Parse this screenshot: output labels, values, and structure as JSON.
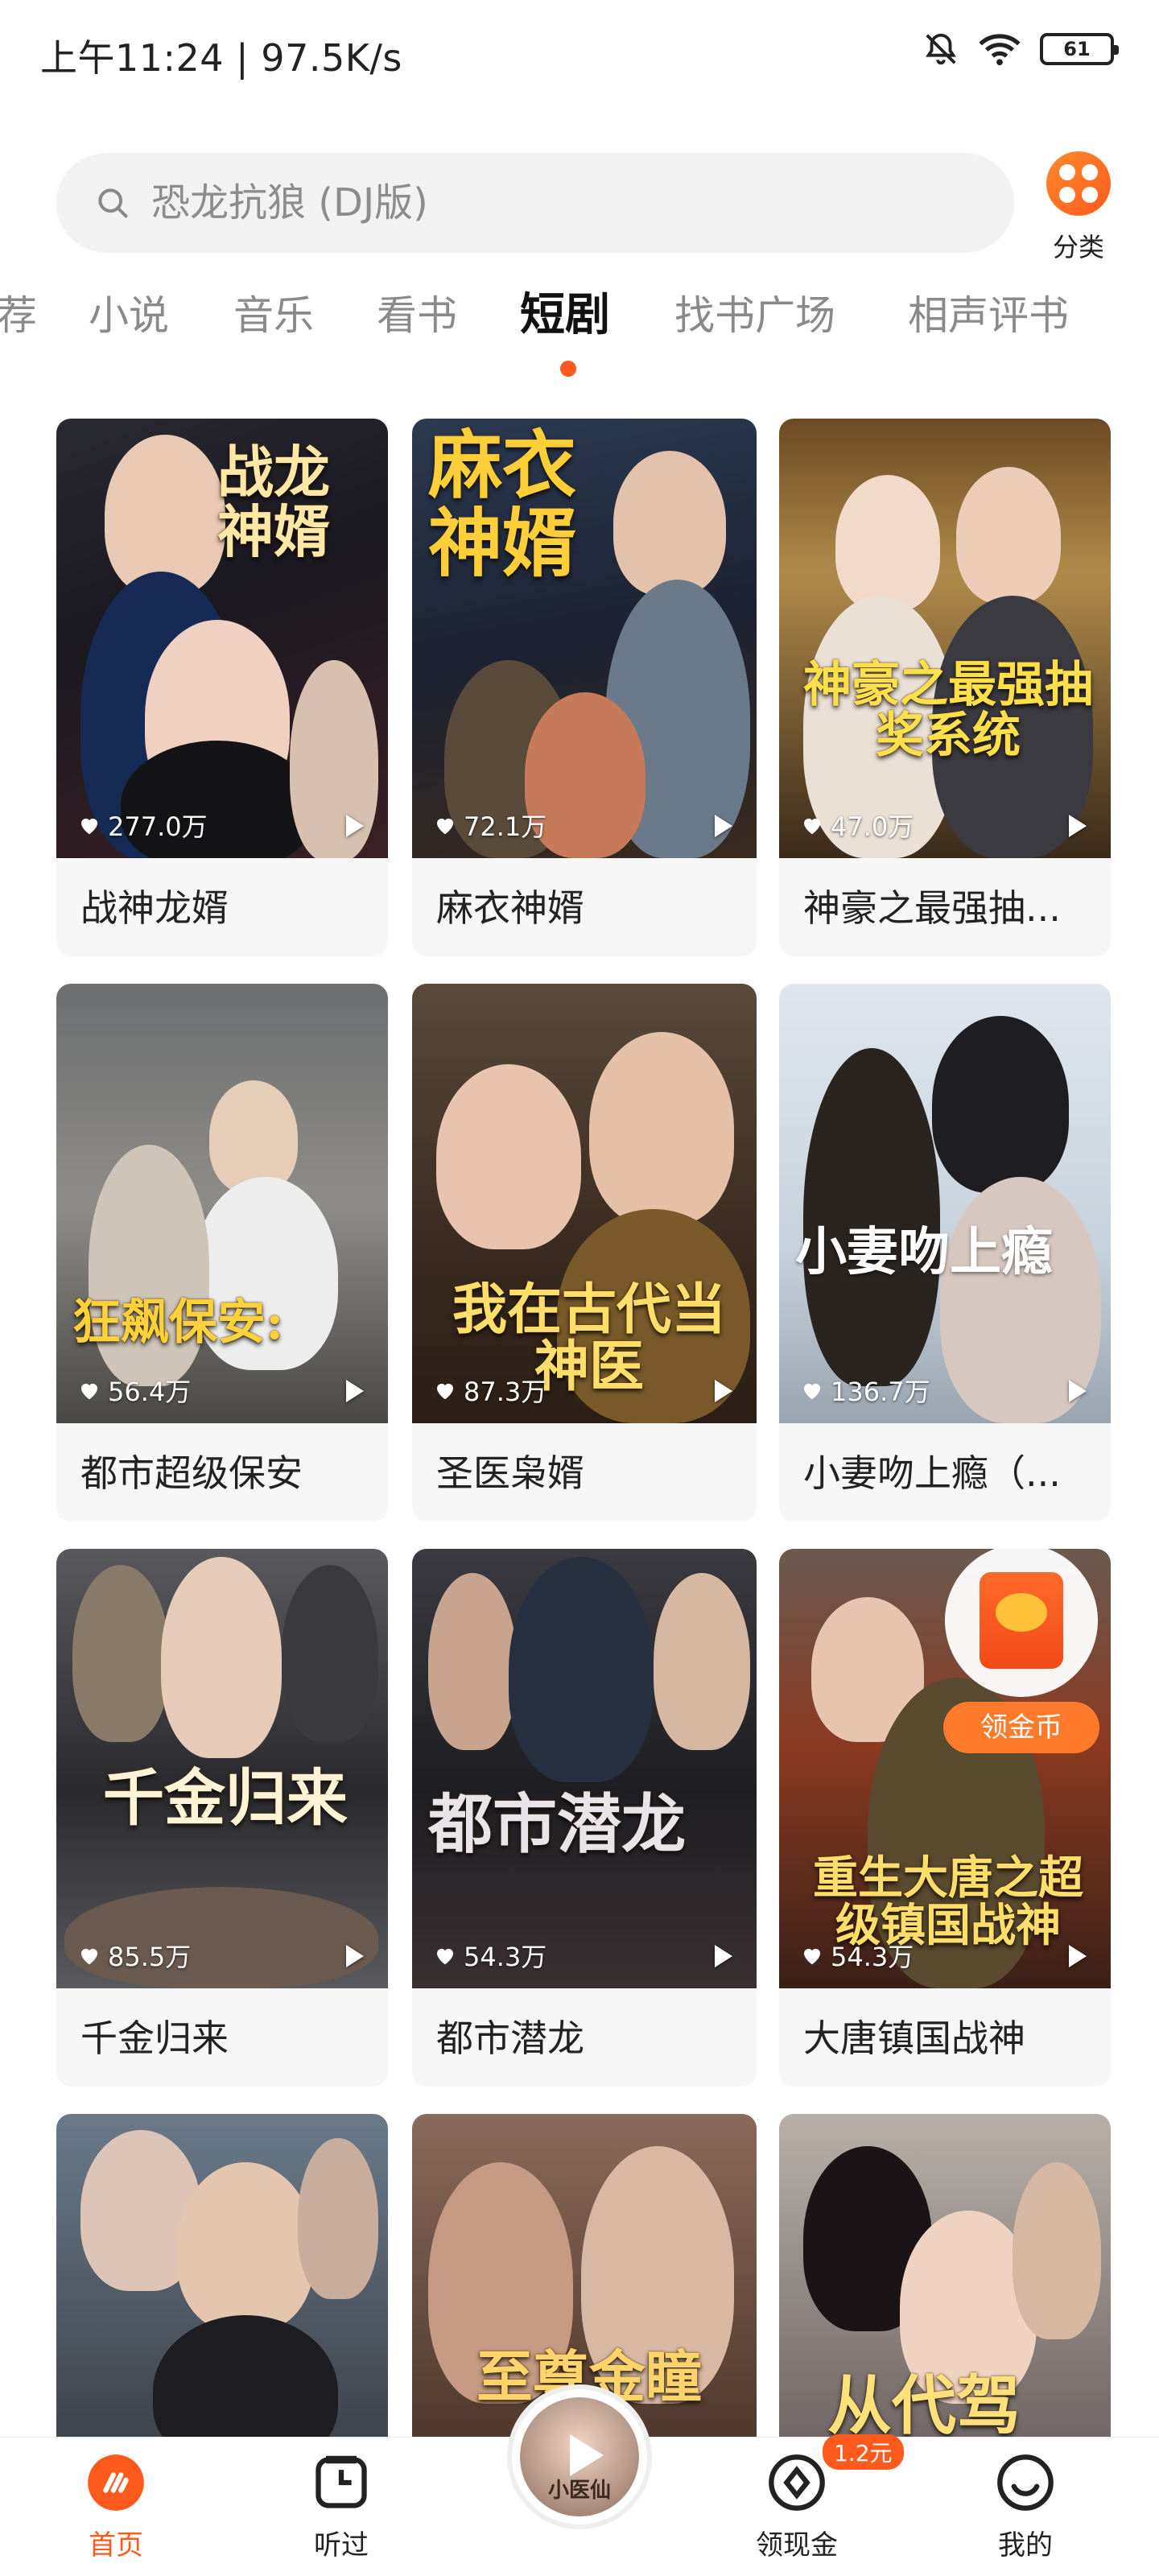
{
  "status_bar": {
    "time_speed": "上午11:24 | 97.5K/s",
    "battery": "61"
  },
  "search": {
    "placeholder": "恐龙抗狼 (DJ版)"
  },
  "category_button": {
    "label": "分类"
  },
  "tabs": [
    {
      "label": "荐"
    },
    {
      "label": "小说"
    },
    {
      "label": "音乐"
    },
    {
      "label": "看书"
    },
    {
      "label": "短剧",
      "active": true
    },
    {
      "label": "找书广场"
    },
    {
      "label": "相声评书"
    }
  ],
  "dramas": [
    {
      "title": "战神龙婿",
      "likes": "277.0万",
      "poster_text": "战龙神婿"
    },
    {
      "title": "麻衣神婿",
      "likes": "72.1万",
      "poster_text": "麻衣神婿"
    },
    {
      "title": "神豪之最强抽...",
      "likes": "47.0万",
      "poster_text": "神豪之最强抽奖系统"
    },
    {
      "title": "都市超级保安",
      "likes": "56.4万",
      "poster_text": "狂飙保安:"
    },
    {
      "title": "圣医枭婿",
      "likes": "87.3万",
      "poster_text": "我在古代当神医"
    },
    {
      "title": "小妻吻上瘾（...",
      "likes": "136.7万",
      "poster_text": "小妻吻上瘾"
    },
    {
      "title": "千金归来",
      "likes": "85.5万",
      "poster_text": "千金归来"
    },
    {
      "title": "都市潜龙",
      "likes": "54.3万",
      "poster_text": "都市潜龙"
    },
    {
      "title": "大唐镇国战神",
      "likes": "54.3万",
      "poster_text": "重生大唐之超级镇国战神"
    },
    {
      "title": "",
      "likes": "",
      "poster_text": ""
    },
    {
      "title": "",
      "likes": "",
      "poster_text": "至尊金瞳"
    },
    {
      "title": "",
      "likes": "",
      "poster_text": "从代驾"
    }
  ],
  "coin_widget": {
    "label": "领金币"
  },
  "bottom_nav": {
    "home": "首页",
    "history": "听过",
    "center_caption": "小医仙",
    "cash": "领现金",
    "cash_badge": "1.2元",
    "mine": "我的"
  },
  "colors": {
    "accent": "#ff5a1e",
    "search_bg": "#f2f2f2",
    "card_bg": "#f7f7f7"
  }
}
